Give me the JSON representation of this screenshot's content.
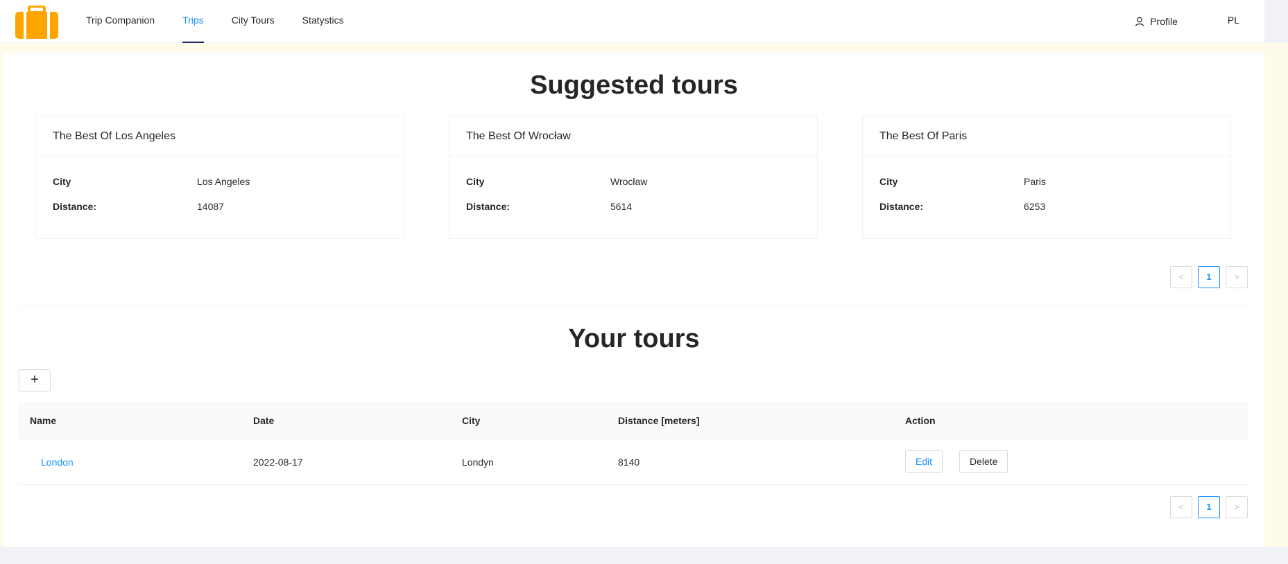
{
  "header": {
    "logo_icon": "suitcase-icon",
    "nav": [
      {
        "label": "Trip Companion"
      },
      {
        "label": "Trips"
      },
      {
        "label": "City Tours"
      },
      {
        "label": "Statystics"
      }
    ],
    "active_nav": "Trips",
    "profile_label": "Profile",
    "profile_icon": "user-icon",
    "language": "PL"
  },
  "suggested": {
    "title": "Suggested tours",
    "cards": [
      {
        "title": "The Best Of Los Angeles",
        "city_label": "City",
        "city": "Los Angeles",
        "distance_label": "Distance:",
        "distance": "14087"
      },
      {
        "title": "The Best Of Wrocław",
        "city_label": "City",
        "city": "Wrocław",
        "distance_label": "Distance:",
        "distance": "5614"
      },
      {
        "title": "The Best Of Paris",
        "city_label": "City",
        "city": "Paris",
        "distance_label": "Distance:",
        "distance": "6253"
      }
    ],
    "pagination": {
      "prev": "<",
      "page": "1",
      "next": ">"
    }
  },
  "your_tours": {
    "title": "Your tours",
    "add_label": "+",
    "columns": [
      "Name",
      "Date",
      "City",
      "Distance [meters]",
      "Action"
    ],
    "rows": [
      {
        "name": "London",
        "date": "2022-08-17",
        "city": "Londyn",
        "distance": "8140",
        "edit": "Edit",
        "delete": "Delete"
      }
    ],
    "pagination": {
      "prev": "<",
      "page": "1",
      "next": ">"
    }
  },
  "colors": {
    "accent": "#1890ff",
    "logo": "#ffa500",
    "frame": "#fffbea",
    "active_underline": "#1d2a5a"
  }
}
